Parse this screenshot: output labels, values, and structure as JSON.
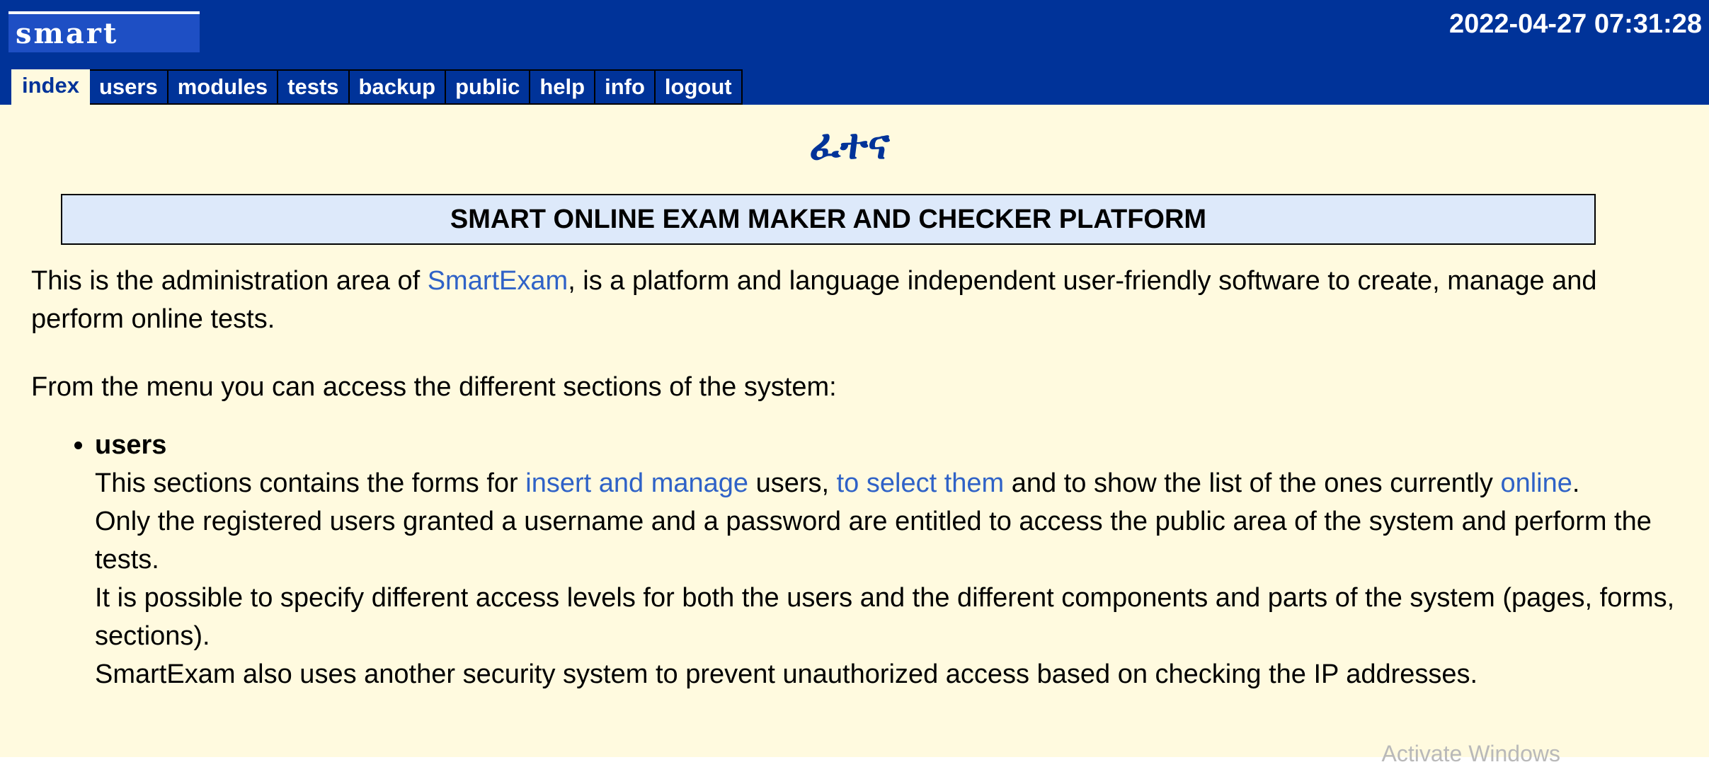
{
  "header": {
    "logo_text": "smart",
    "timestamp": "2022-04-27 07:31:28",
    "tabs": [
      {
        "label": "index",
        "active": true
      },
      {
        "label": "users"
      },
      {
        "label": "modules"
      },
      {
        "label": "tests"
      },
      {
        "label": "backup"
      },
      {
        "label": "public"
      },
      {
        "label": "help"
      },
      {
        "label": "info"
      },
      {
        "label": "logout"
      }
    ]
  },
  "main": {
    "amharic_title": "ፈተና",
    "banner": "SMART ONLINE EXAM MAKER AND CHECKER PLATFORM",
    "intro": {
      "before": "This is the administration area of ",
      "link": "SmartExam",
      "after": ", is a platform and language independent user-friendly software to create, manage and perform online tests."
    },
    "menu_intro": "From the menu you can access the different sections of the system:",
    "users_section": {
      "title": "users",
      "line1_a": "This sections contains the forms for ",
      "link_insert": "insert and manage",
      "line1_b": " users, ",
      "link_select": "to select them",
      "line1_c": " and to show the list of the ones currently ",
      "link_online": "online",
      "line1_d": ".",
      "line2": "Only the registered users granted a username and a password are entitled to access the public area of the system and perform the tests.",
      "line3": "It is possible to specify different access levels for both the users and the different components and parts of the system (pages, forms, sections).",
      "line4": "SmartExam also uses another security system to prevent unauthorized access based on checking the IP addresses."
    }
  },
  "watermark": "Activate Windows",
  "colors": {
    "header_bg": "#003399",
    "content_bg": "#fffadf",
    "banner_bg": "#dde9fa",
    "link": "#2f62c7"
  }
}
